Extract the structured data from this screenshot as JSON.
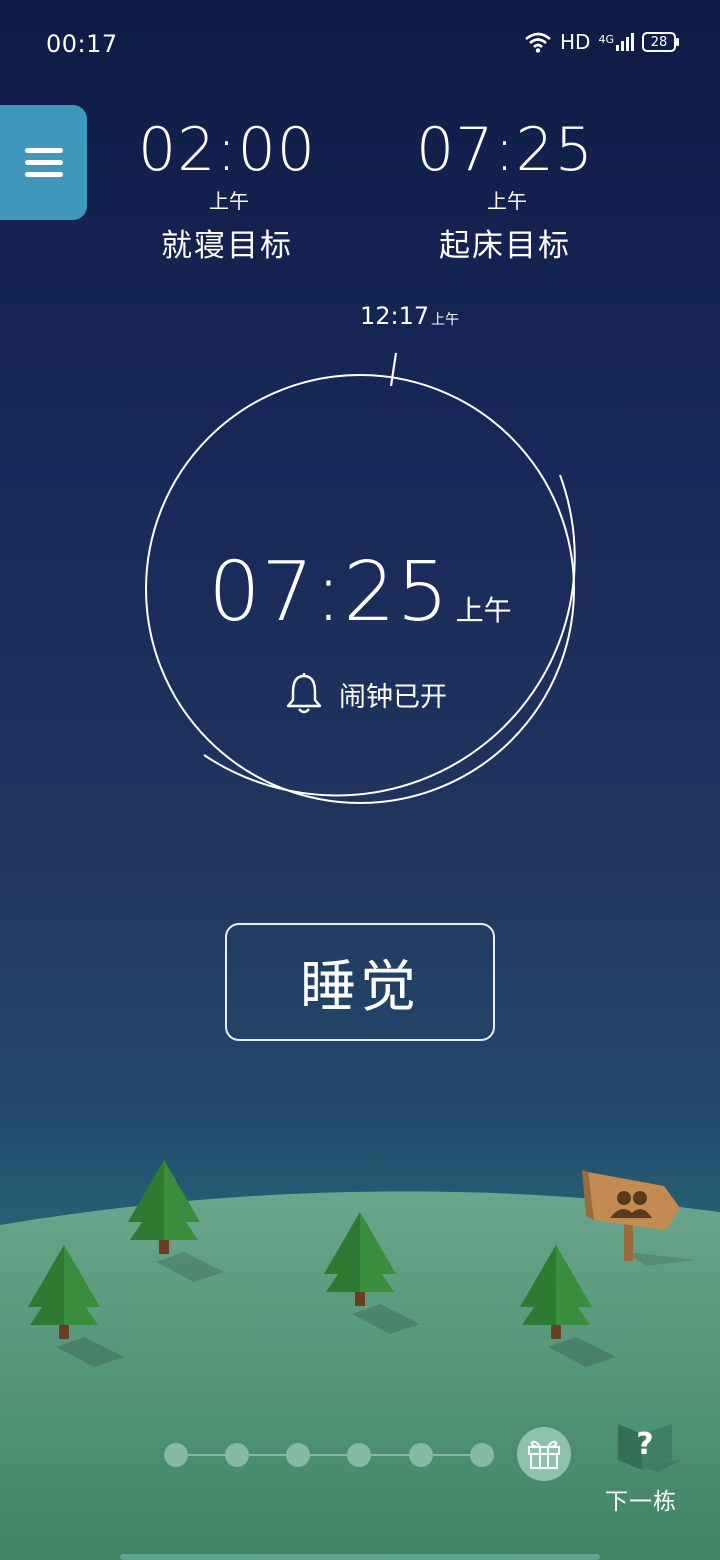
{
  "status_bar": {
    "time": "00:17",
    "network": "HD",
    "signal": "4G",
    "battery": "28"
  },
  "goals": {
    "bedtime": {
      "time": "02:00",
      "ampm": "上午",
      "label": "就寝目标"
    },
    "wake": {
      "time": "07:25",
      "ampm": "上午",
      "label": "起床目标"
    }
  },
  "clock": {
    "current_time": "12:17",
    "current_ampm": "上午",
    "alarm_time": "07:25",
    "alarm_ampm": "上午",
    "alarm_status": "闹钟已开"
  },
  "sleep_button": {
    "label": "睡觉"
  },
  "progress": {
    "filled_days": 6,
    "total_days": 7
  },
  "next_building": {
    "label": "下一栋"
  },
  "icons": [
    "menu-icon",
    "wifi-icon",
    "signal-icon",
    "battery-icon",
    "bell-icon",
    "gift-icon",
    "group-sign-icon",
    "question-building-icon"
  ],
  "colors": {
    "menu_bg": "#3f97bc",
    "hill": "#5c9a83",
    "tree": "#3b8a3e"
  }
}
